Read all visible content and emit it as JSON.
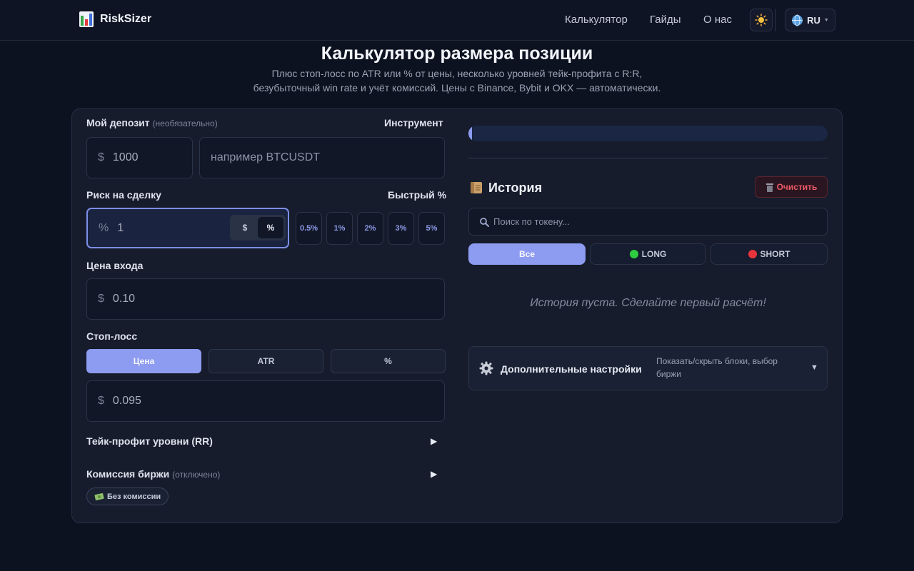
{
  "header": {
    "brand": "RiskSizer",
    "nav": [
      "Калькулятор",
      "Гайды",
      "О нас"
    ],
    "theme_icon": "sun-icon",
    "lang": "RU"
  },
  "hero": {
    "title": "Калькулятор размера позиции",
    "subtitle_line1": "Плюс стоп-лосс по ATR или % от цены, несколько уровней тейк-профита с R:R,",
    "subtitle_line2": "безубыточный win rate и учёт комиссий. Цены с Binance, Bybit и OKX — автоматически."
  },
  "form": {
    "deposit_label": "Мой депозит",
    "deposit_optional": "(необязательно)",
    "instrument_label": "Инструмент",
    "deposit_currency": "$",
    "deposit_value": "1000",
    "instrument_placeholder": "например BTCUSDT",
    "risk_label": "Риск на сделку",
    "quick_label": "Быстрый %",
    "risk_unit": "%",
    "risk_value": "1",
    "risk_toggle": [
      "$",
      "%"
    ],
    "quick": [
      "0.5%",
      "1%",
      "2%",
      "3%",
      "5%"
    ],
    "entry_label": "Цена входа",
    "entry_currency": "$",
    "entry_value": "0.10",
    "stop_label": "Стоп-лосс",
    "stop_tabs": [
      "Цена",
      "ATR",
      "%"
    ],
    "stop_currency": "$",
    "stop_value": "0.095",
    "tp_label": "Тейк-профит уровни (RR)",
    "fee_label": "Комиссия биржи",
    "fee_status": "(отключено)",
    "fee_chip": "Без комиссии",
    "expand_arrow": "▶"
  },
  "history": {
    "progress_fraction": 0.01,
    "title": "История",
    "clear_label": "Очистить",
    "search_placeholder": "Поиск по токену...",
    "filters": [
      "Все",
      "LONG",
      "SHORT"
    ],
    "empty_text": "История пуста. Сделайте первый расчёт!",
    "advanced_title": "Дополнительные настройки",
    "advanced_desc_1": "Показать/скрыть блоки, выбор",
    "advanced_desc_2": "биржи",
    "advanced_arrow": "▼"
  },
  "colors": {
    "accent": "#8d9bf0",
    "long": "#2ecc40",
    "short": "#e8343c",
    "danger": "#ef5a68"
  }
}
